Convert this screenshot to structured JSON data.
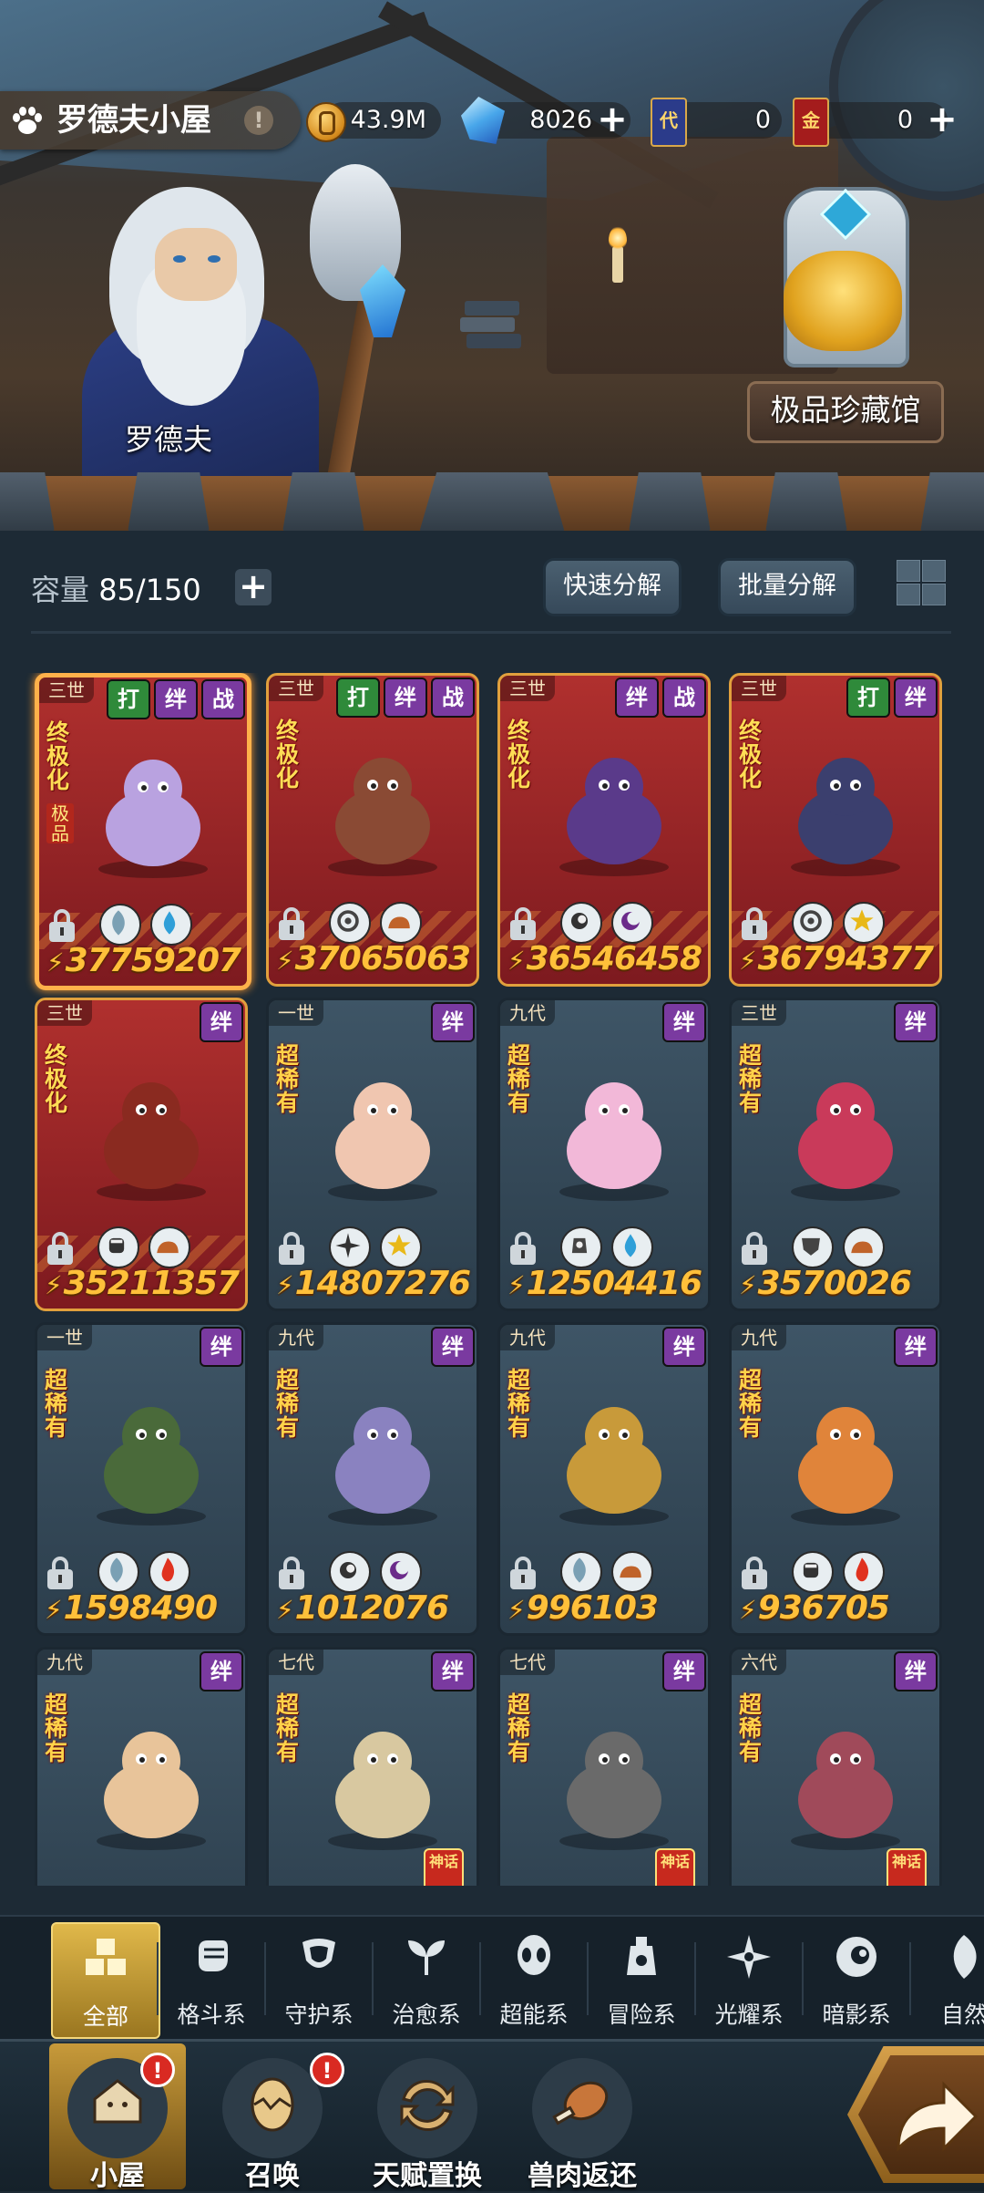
{
  "hud": {
    "title": "罗德夫小屋",
    "info": "!",
    "gold": "43.9M",
    "crystal": "8026",
    "ticket_dai_label": "代",
    "ticket_dai": "0",
    "ticket_jin_label": "金",
    "ticket_jin": "0",
    "plus": "+"
  },
  "scene": {
    "npc_name": "罗德夫",
    "treasure_hall": "极品珍藏馆"
  },
  "toolbar": {
    "capacity_label": "容量",
    "capacity_value": "85/150",
    "add": "+",
    "quick_decompose": "快速分解",
    "batch_decompose": "批量分解"
  },
  "cards": [
    {
      "gen": "三世",
      "tags": [
        "打",
        "绊",
        "战"
      ],
      "rarity": "终极化",
      "sub": "极品",
      "power": "37759207",
      "attrs": [
        "leaf-icon",
        "water-icon"
      ],
      "style": "red"
    },
    {
      "gen": "三世",
      "tags": [
        "打",
        "绊",
        "战"
      ],
      "rarity": "终极化",
      "power": "37065063",
      "attrs": [
        "shield-icon",
        "rock-icon"
      ],
      "style": "red"
    },
    {
      "gen": "三世",
      "tags": [
        "绊",
        "战"
      ],
      "rarity": "终极化",
      "power": "36546458",
      "attrs": [
        "dark-icon",
        "psychic-icon"
      ],
      "style": "red"
    },
    {
      "gen": "三世",
      "tags": [
        "打",
        "绊"
      ],
      "rarity": "终极化",
      "power": "36794377",
      "attrs": [
        "shield-icon",
        "light-icon"
      ],
      "style": "red"
    },
    {
      "gen": "三世",
      "tags": [
        "绊"
      ],
      "rarity": "终极化",
      "power": "35211357",
      "attrs": [
        "fist-icon",
        "rock-icon"
      ],
      "style": "red"
    },
    {
      "gen": "一世",
      "tags": [
        "绊"
      ],
      "rarity": "超稀有",
      "power": "14807276",
      "attrs": [
        "star-icon",
        "light-icon"
      ],
      "style": "blue"
    },
    {
      "gen": "九代",
      "tags": [
        "绊"
      ],
      "rarity": "超稀有",
      "power": "12504416",
      "attrs": [
        "adventure-icon",
        "water-icon"
      ],
      "style": "blue"
    },
    {
      "gen": "三世",
      "tags": [
        "绊"
      ],
      "rarity": "超稀有",
      "power": "3570026",
      "attrs": [
        "guard-icon",
        "rock-icon"
      ],
      "style": "blue"
    },
    {
      "gen": "一世",
      "tags": [
        "绊"
      ],
      "rarity": "超稀有",
      "power": "1598490",
      "attrs": [
        "leaf-icon",
        "fire-icon"
      ],
      "style": "blue"
    },
    {
      "gen": "九代",
      "tags": [
        "绊"
      ],
      "rarity": "超稀有",
      "power": "1012076",
      "attrs": [
        "dark-icon",
        "psychic-icon"
      ],
      "style": "blue"
    },
    {
      "gen": "九代",
      "tags": [
        "绊"
      ],
      "rarity": "超稀有",
      "power": "996103",
      "attrs": [
        "leaf-icon",
        "rock-icon"
      ],
      "style": "blue"
    },
    {
      "gen": "九代",
      "tags": [
        "绊"
      ],
      "rarity": "超稀有",
      "power": "936705",
      "attrs": [
        "fist-icon",
        "fire-icon"
      ],
      "style": "blue"
    },
    {
      "gen": "九代",
      "tags": [
        "绊"
      ],
      "rarity": "超稀有",
      "power": "",
      "attrs": [],
      "style": "blue"
    },
    {
      "gen": "七代",
      "tags": [
        "绊"
      ],
      "rarity": "超稀有",
      "power": "",
      "attrs": [],
      "style": "blue",
      "chip": "神话"
    },
    {
      "gen": "七代",
      "tags": [
        "绊"
      ],
      "rarity": "超稀有",
      "power": "",
      "attrs": [],
      "style": "blue",
      "chip": "神话"
    },
    {
      "gen": "六代",
      "tags": [
        "绊"
      ],
      "rarity": "超稀有",
      "power": "",
      "attrs": [],
      "style": "blue",
      "chip": "神话"
    }
  ],
  "filters": [
    {
      "label": "全部",
      "icon": "all-icon",
      "active": true
    },
    {
      "label": "格斗系",
      "icon": "fist-icon"
    },
    {
      "label": "守护系",
      "icon": "shield-icon"
    },
    {
      "label": "治愈系",
      "icon": "sprout-icon"
    },
    {
      "label": "超能系",
      "icon": "alien-icon"
    },
    {
      "label": "冒险系",
      "icon": "lantern-icon"
    },
    {
      "label": "光耀系",
      "icon": "star-icon"
    },
    {
      "label": "暗影系",
      "icon": "eye-icon"
    },
    {
      "label": "自然",
      "icon": "leaf-icon"
    }
  ],
  "bottom_nav": [
    {
      "label": "小屋",
      "icon": "house-icon",
      "active": true,
      "badge": "!"
    },
    {
      "label": "召唤",
      "icon": "egg-icon",
      "badge": "!"
    },
    {
      "label": "天赋置换",
      "icon": "swap-icon"
    },
    {
      "label": "兽肉返还",
      "icon": "meat-icon"
    }
  ],
  "colors": {
    "background": "#1d2a35",
    "card_red": "#b0302e",
    "card_blue": "#3e5566",
    "power_gold": "#ffc03a",
    "tag_green": "#2f8a3a",
    "tag_purple": "#7a3aa0",
    "active_gold": "#e0b84a"
  }
}
